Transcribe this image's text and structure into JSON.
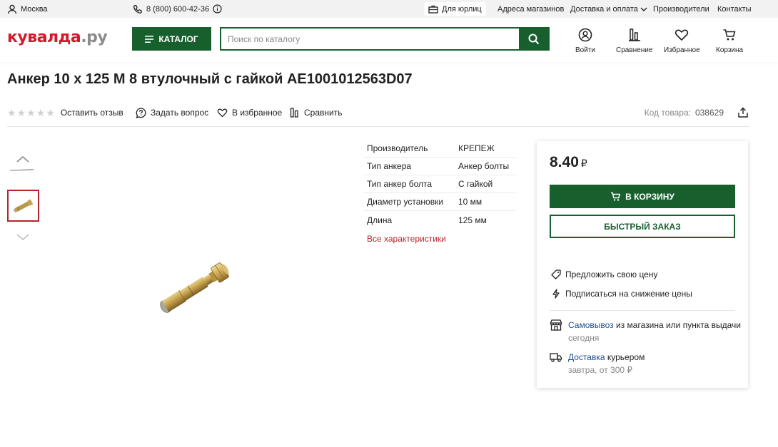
{
  "topbar": {
    "city": "Москва",
    "phone": "8 (800) 600-42-36",
    "legal": "Для юрлиц",
    "links": [
      "Адреса магазинов",
      "Доставка и оплата",
      "Производители",
      "Контакты"
    ]
  },
  "header": {
    "logo_main": "кувалда",
    "logo_domain": ".ру",
    "catalog_label": "КАТАЛОГ",
    "search_placeholder": "Поиск по каталогу",
    "icons": [
      {
        "label": "Войти",
        "icon": "user-icon"
      },
      {
        "label": "Сравнение",
        "icon": "compare-icon"
      },
      {
        "label": "Избранное",
        "icon": "heart-icon"
      },
      {
        "label": "Корзина",
        "icon": "cart-icon"
      }
    ]
  },
  "product": {
    "title": "Анкер 10 х 125 М 8 втулочный с гайкой AE1001012563D07",
    "rating_stars": 0,
    "actions": {
      "review": "Оставить отзыв",
      "question": "Задать вопрос",
      "favorite": "В избранное",
      "compare": "Сравнить"
    },
    "code_label": "Код товара:",
    "code_value": "038629"
  },
  "specs": [
    {
      "k": "Производитель",
      "v": "КРЕПЕЖ"
    },
    {
      "k": "Тип анкера",
      "v": "Анкер болты"
    },
    {
      "k": "Тип анкер болта",
      "v": "С гайкой"
    },
    {
      "k": "Диаметр установки",
      "v": "10 мм"
    },
    {
      "k": "Длина",
      "v": "125 мм"
    }
  ],
  "all_specs_label": "Все характеристики",
  "buybox": {
    "price": "8.40",
    "currency": "₽",
    "cart_label": "В КОРЗИНУ",
    "quick_label": "БЫСТРЫЙ ЗАКАЗ",
    "offer_price": "Предложить свою цену",
    "subscribe": "Подписаться на снижение цены",
    "pickup_link": "Самовывоз",
    "pickup_text": " из магазина или пункта выдачи",
    "pickup_when": "сегодня",
    "delivery_link": "Доставка",
    "delivery_text": " курьером",
    "delivery_when": "завтра, от 300 ₽"
  },
  "colors": {
    "brand_green": "#17602e",
    "brand_red": "#d4192b",
    "link_red": "#b3262b",
    "link_blue": "#1f4f8f"
  }
}
